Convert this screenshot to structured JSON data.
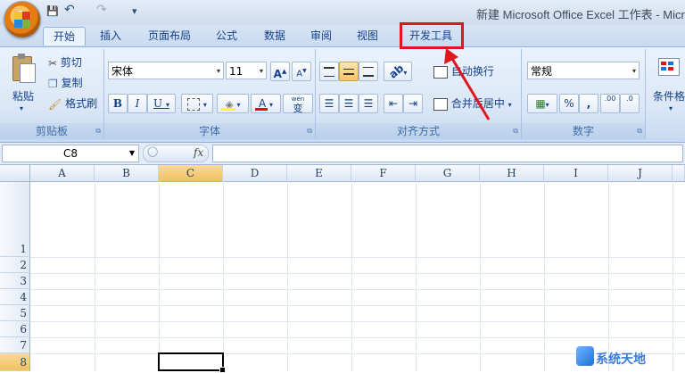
{
  "window": {
    "title": "新建 Microsoft Office Excel 工作表 - Micr"
  },
  "quick_access": {
    "save": "💾",
    "undo": "↶",
    "redo": "↷",
    "more": "▾"
  },
  "tabs": [
    {
      "label": "开始",
      "active": true
    },
    {
      "label": "插入"
    },
    {
      "label": "页面布局"
    },
    {
      "label": "公式"
    },
    {
      "label": "数据"
    },
    {
      "label": "审阅"
    },
    {
      "label": "视图"
    },
    {
      "label": "开发工具",
      "highlighted": true
    }
  ],
  "clipboard": {
    "label": "剪贴板",
    "paste": "粘贴",
    "cut": "剪切",
    "copy": "复制",
    "format_painter": "格式刷"
  },
  "font": {
    "label": "字体",
    "family": "宋体",
    "size": "11",
    "grow": "A",
    "shrink": "A",
    "bold": "B",
    "italic": "I",
    "underline": "U",
    "phonetic": "wén",
    "phonetic_char": "变",
    "fill_color": "#ffff00",
    "font_color": "#ff0000",
    "font_color_letter": "A"
  },
  "alignment": {
    "label": "对齐方式",
    "wrap": "自动换行",
    "merge": "合并后居中"
  },
  "number": {
    "label": "数字",
    "format": "常规",
    "percent": "%",
    "comma": ",",
    "increase_decimal": ".00",
    "decrease_decimal": ".0"
  },
  "styles": {
    "conditional": "条件格"
  },
  "formula_bar": {
    "name_box": "C8",
    "fx": "fx",
    "value": ""
  },
  "sheet": {
    "columns": [
      "A",
      "B",
      "C",
      "D",
      "E",
      "F",
      "G",
      "H",
      "I",
      "J"
    ],
    "rows": [
      "1",
      "2",
      "3",
      "4",
      "5",
      "6",
      "7",
      "8"
    ],
    "active_cell": "C8",
    "active_column": "C",
    "active_row": "8"
  },
  "annotation": {
    "highlight_color": "#e0161e"
  },
  "watermark": {
    "text": "系统天地"
  }
}
